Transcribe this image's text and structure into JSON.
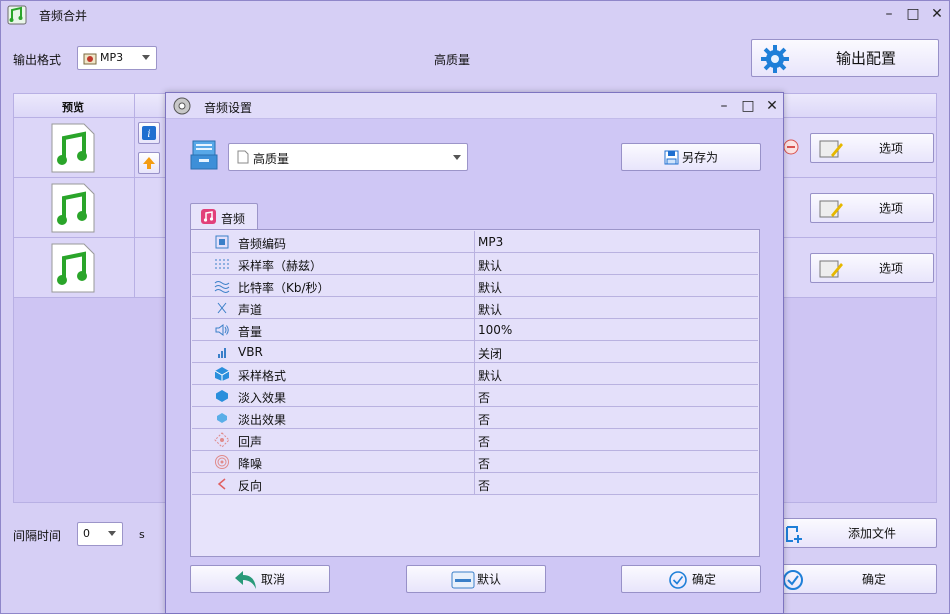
{
  "app": {
    "title": "音频合并",
    "output_format_label": "输出格式",
    "output_format_value": "MP3",
    "quality_label": "高质量",
    "output_config_button": "输出配置",
    "grid_header_preview": "预览",
    "option_button": "选项",
    "interval_label": "间隔时间",
    "interval_value": "0",
    "interval_unit": "s",
    "add_file_button": "添加文件",
    "confirm_button": "确定"
  },
  "dialog": {
    "title": "音频设置",
    "preset_value": "高质量",
    "save_as_button": "另存为",
    "tab_audio": "音频",
    "cancel_button": "取消",
    "default_button": "默认",
    "confirm_button": "确定",
    "properties": [
      {
        "name": "音频编码",
        "value": "MP3",
        "icon": "codec-icon"
      },
      {
        "name": "采样率（赫兹）",
        "value": "默认",
        "icon": "sample-rate-icon"
      },
      {
        "name": "比特率（Kb/秒）",
        "value": "默认",
        "icon": "bitrate-icon"
      },
      {
        "name": "声道",
        "value": "默认",
        "icon": "channel-icon"
      },
      {
        "name": "音量",
        "value": "100%",
        "icon": "volume-icon"
      },
      {
        "name": "VBR",
        "value": "关闭",
        "icon": "vbr-icon"
      },
      {
        "name": "采样格式",
        "value": "默认",
        "icon": "sample-format-icon"
      },
      {
        "name": "淡入效果",
        "value": "否",
        "icon": "fade-in-icon"
      },
      {
        "name": "淡出效果",
        "value": "否",
        "icon": "fade-out-icon"
      },
      {
        "name": "回声",
        "value": "否",
        "icon": "echo-icon"
      },
      {
        "name": "降噪",
        "value": "否",
        "icon": "denoise-icon"
      },
      {
        "name": "反向",
        "value": "否",
        "icon": "reverse-icon"
      }
    ]
  },
  "colors": {
    "window_bg": "#d6cff5",
    "accent_blue": "#1f7fd8",
    "music_green": "#2aa52a"
  }
}
